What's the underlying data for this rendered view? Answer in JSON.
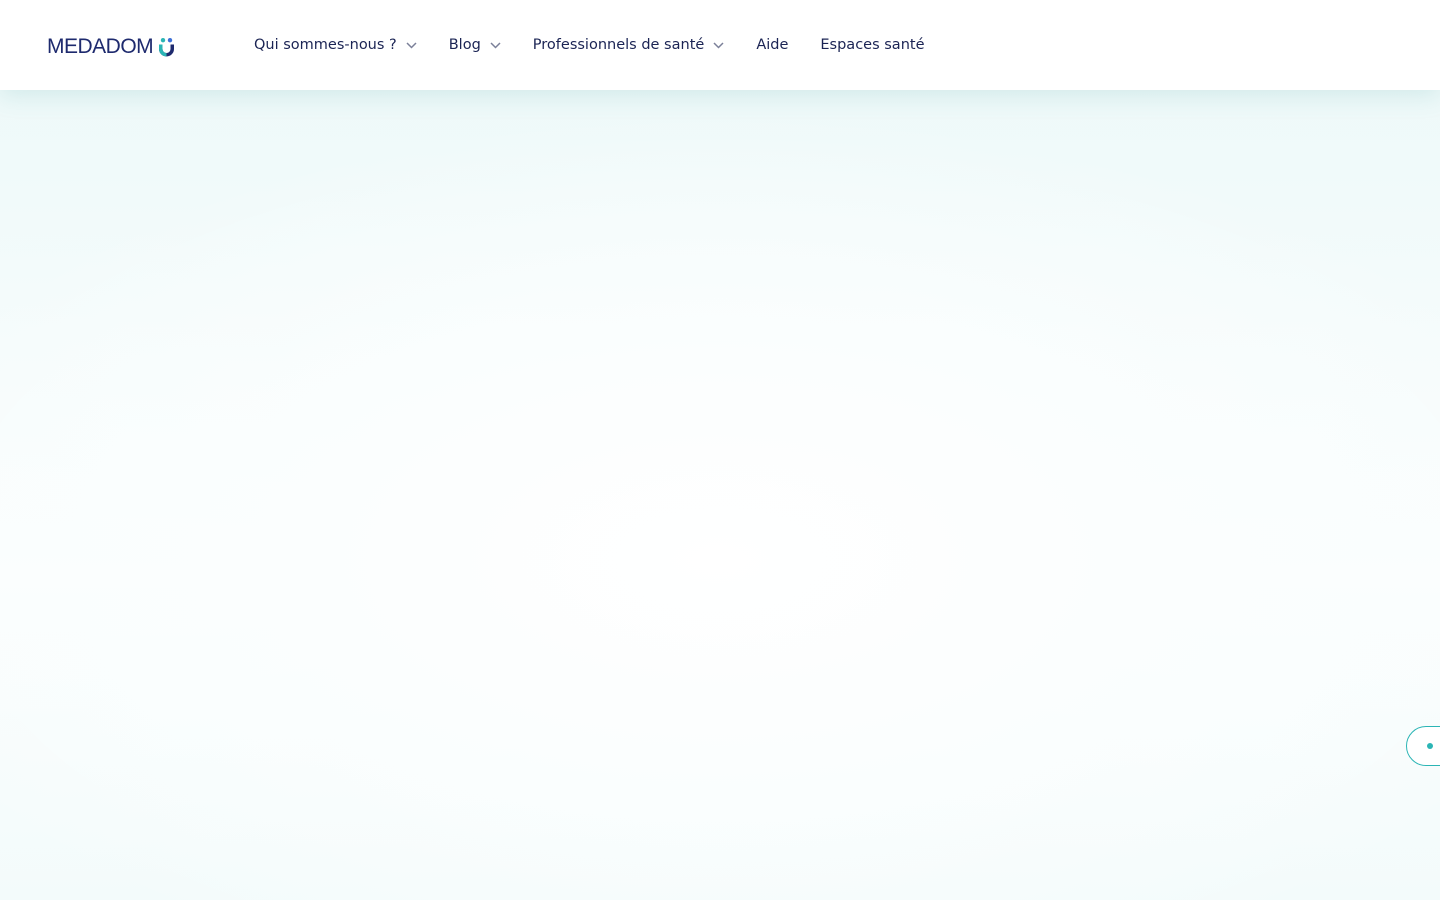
{
  "header": {
    "logo_text": "MEDADOM",
    "nav": [
      {
        "label": "Qui sommes-nous ?",
        "has_dropdown": true
      },
      {
        "label": "Blog",
        "has_dropdown": true
      },
      {
        "label": "Professionnels de santé",
        "has_dropdown": true
      },
      {
        "label": "Aide",
        "has_dropdown": false
      },
      {
        "label": "Espaces santé",
        "has_dropdown": false
      }
    ]
  },
  "colors": {
    "brand_navy": "#1e2a6e",
    "brand_teal": "#2bb5b5",
    "brand_blue": "#3c6fd6",
    "hero_tint": "#eef9f9"
  },
  "icons": {
    "logo_mark": "medadom-logo-mark-icon",
    "dropdown": "chevron-down-icon",
    "side_tab": "dot-icon"
  }
}
